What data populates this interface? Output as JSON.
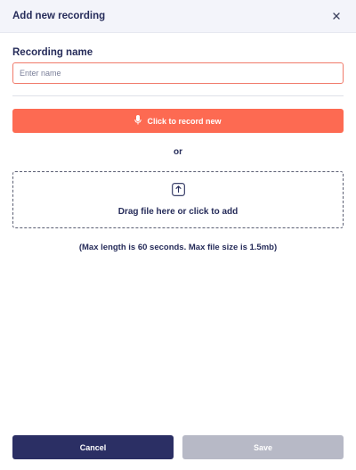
{
  "dialog": {
    "title": "Add new recording",
    "close_icon": "close-icon"
  },
  "name_field": {
    "label": "Recording name",
    "value": "",
    "placeholder": "Enter name"
  },
  "record": {
    "label": "Click to record new",
    "icon": "microphone-icon"
  },
  "separator_text": "or",
  "dropzone": {
    "label": "Drag file here or click to add",
    "icon": "upload-icon"
  },
  "limits_note": "(Max length is 60 seconds. Max file size is 1.5mb)",
  "footer": {
    "cancel_label": "Cancel",
    "save_label": "Save"
  },
  "colors": {
    "primary": "#2b2f64",
    "accent": "#fd6a52",
    "disabled": "#b7b9c6"
  }
}
